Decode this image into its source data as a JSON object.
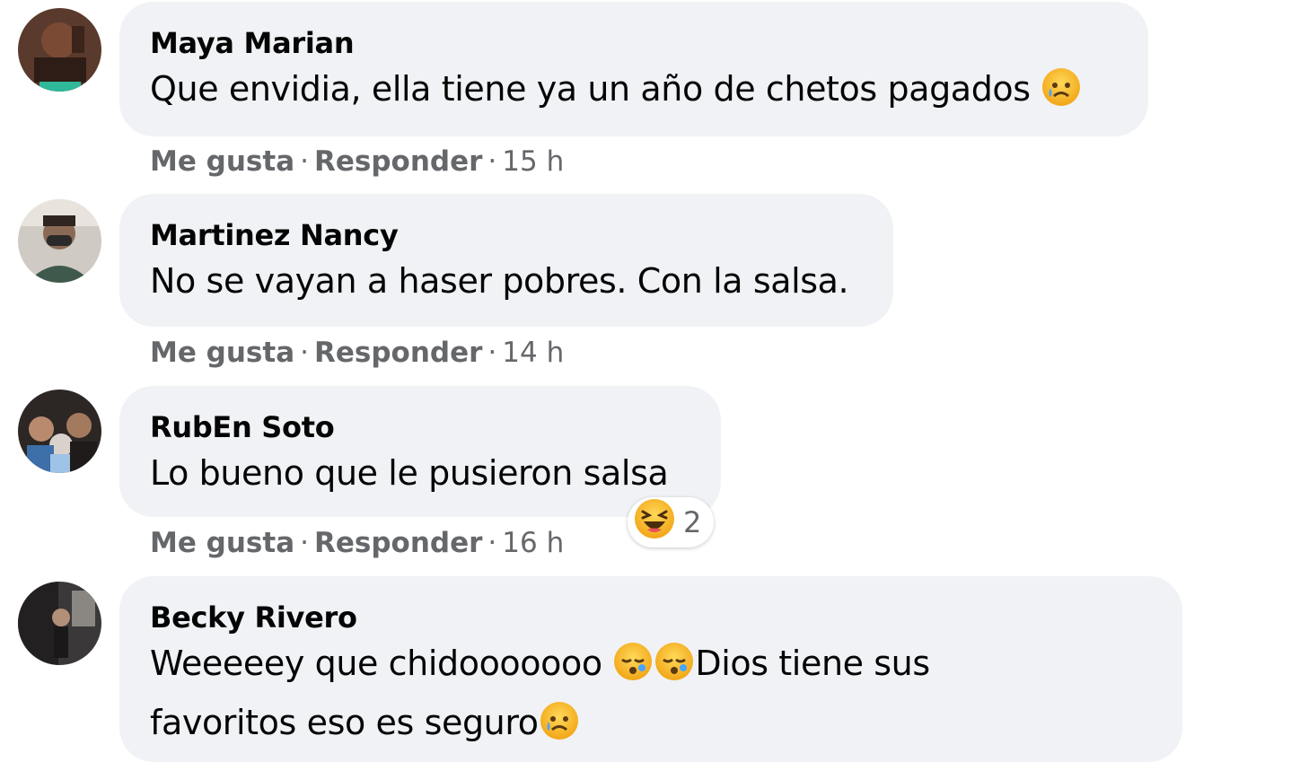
{
  "actions": {
    "like_label": "Me gusta",
    "reply_label": "Responder",
    "separator": "·"
  },
  "comments": [
    {
      "author": "Maya Marian",
      "text": "Que envidia, ella tiene ya un año de chetos pagados",
      "emoji": "sad-tear-emoji",
      "time": "15 h"
    },
    {
      "author": "Martinez Nancy",
      "text": "No se vayan a haser pobres. Con la salsa.",
      "time": "14 h"
    },
    {
      "author": "RubEn Soto",
      "text": "Lo bueno que le pusieron salsa",
      "time": "16 h",
      "reactions": {
        "icon": "laughing-reaction-icon",
        "count": "2"
      }
    },
    {
      "author": "Becky Rivero",
      "text_line1": "Weeeeey que chidooooooo",
      "text_mid": "Dios tiene sus",
      "text_line2": "favoritos eso es seguro",
      "emojis": [
        "sleepy-emoji",
        "sleepy-emoji",
        "sad-tear-emoji"
      ]
    }
  ],
  "colors": {
    "bubble": "#f0f2f5",
    "text": "#050505",
    "secondary_text": "#65676b",
    "emoji_yellow": "#f7b125"
  }
}
